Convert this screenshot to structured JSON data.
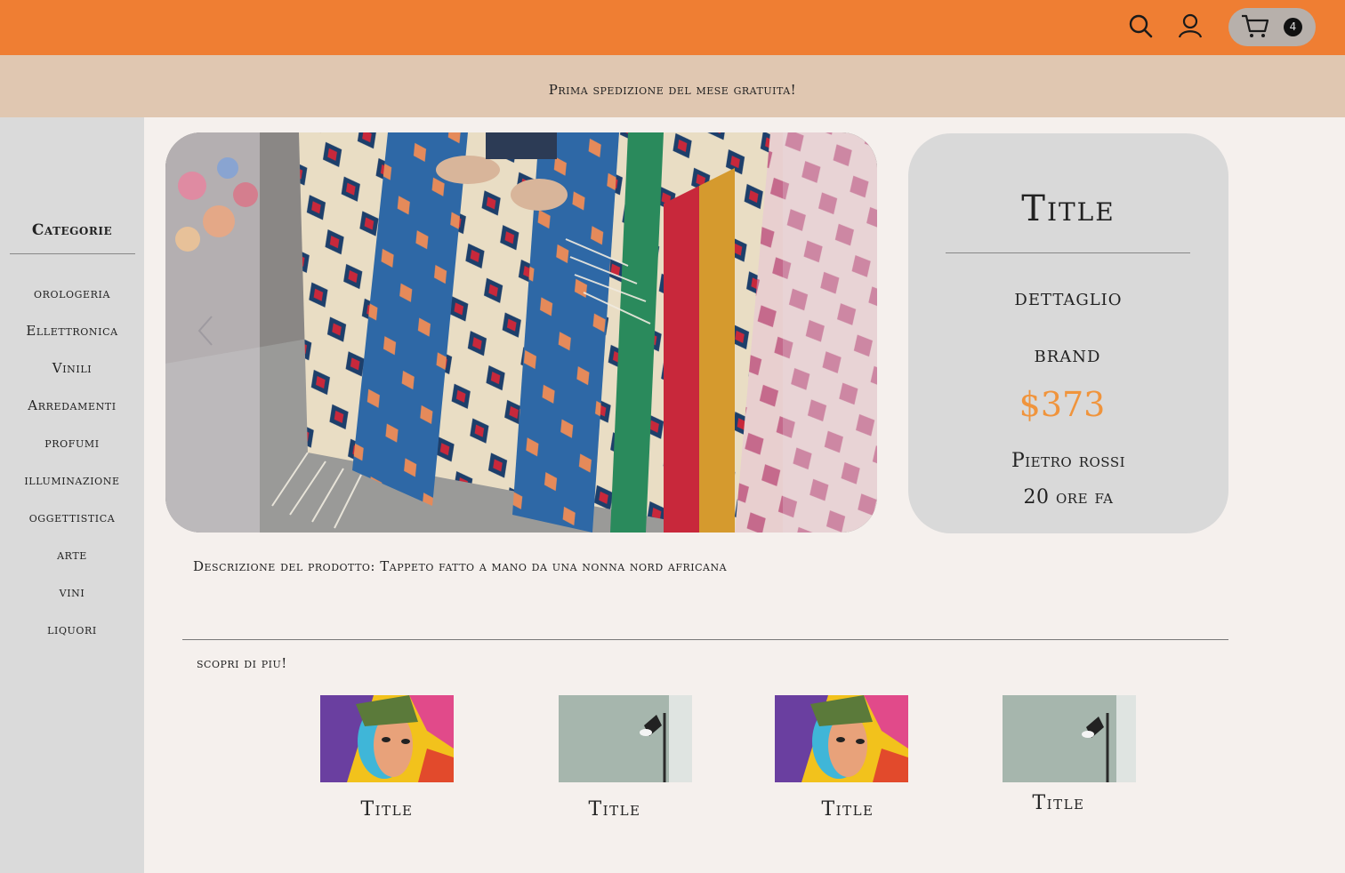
{
  "header": {
    "search_icon": "search-icon",
    "account_icon": "user-icon",
    "cart": {
      "icon": "cart-icon",
      "count": "4"
    },
    "colors": {
      "header_bg": "#ef7e33",
      "banner_bg": "#e0c7b1",
      "accent_price": "#f0943c"
    }
  },
  "banner": {
    "text": "Prima spedizione del mese gratuita!"
  },
  "sidebar": {
    "title": "Categorie",
    "items": [
      {
        "label": "orologeria"
      },
      {
        "label": "Ellettronica"
      },
      {
        "label": "Vinili"
      },
      {
        "label": "Arredamenti"
      },
      {
        "label": "profumi"
      },
      {
        "label": "illuminazione"
      },
      {
        "label": "oggettistica"
      },
      {
        "label": "arte"
      },
      {
        "label": "vini"
      },
      {
        "label": "liquori"
      }
    ]
  },
  "product": {
    "image": "handmade-rug-photo",
    "title": "Title",
    "detail": "dettaglio",
    "brand": "brand",
    "price": "$373",
    "seller": "Pietro rossi",
    "posted": "20 ore fa",
    "description": "Descrizione del prodotto: Tappeto fatto a mano da una nonna nord africana"
  },
  "related": {
    "heading": "scopri di piu!",
    "items": [
      {
        "title": "Title",
        "image": "abstract-portrait-painting"
      },
      {
        "title": "Title",
        "image": "wall-lamp-photo"
      },
      {
        "title": "Title",
        "image": "abstract-portrait-painting"
      },
      {
        "title": "Title",
        "image": "wall-lamp-photo"
      }
    ]
  }
}
